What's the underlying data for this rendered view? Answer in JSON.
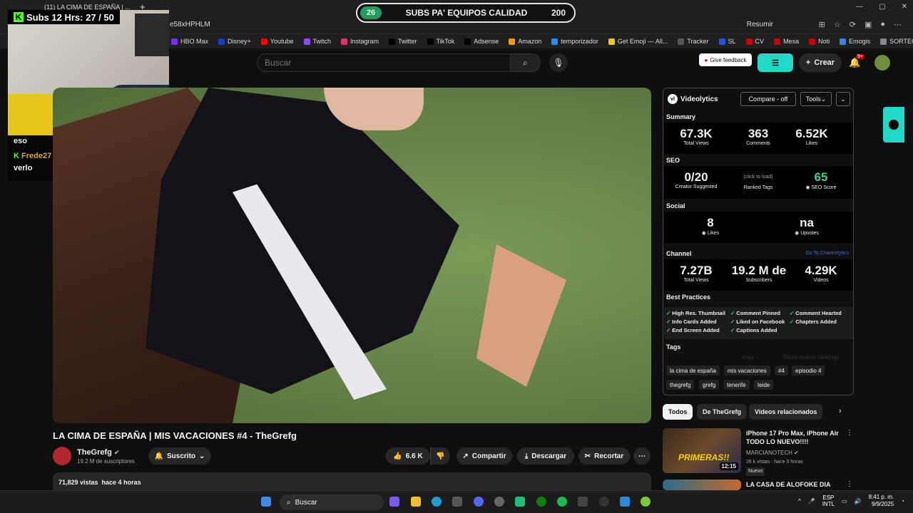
{
  "browser": {
    "tab_title": "(11) LA CIMA DE ESPAÑA | ...",
    "url": "e58xHPHLM",
    "resumir": "Resumir",
    "bookmarks": [
      "HBO Max",
      "Disney+",
      "Youtube",
      "Twitch",
      "Instagram",
      "Twitter",
      "TikTok",
      "Adsense",
      "Amazon",
      "temporizador",
      "Get Emoji — All...",
      "Tracker",
      "SL",
      "CV",
      "Mesa",
      "Noti",
      "Emogis",
      "SORTEO PICKER"
    ],
    "bookmark_colors": [
      "#7b2cf5",
      "#1a3cc8",
      "#ff0000",
      "#9146ff",
      "#e1306c",
      "#000000",
      "#000000",
      "#000000",
      "#ff9900",
      "#1e90ff",
      "#f5c518",
      "#555555",
      "#2455d6",
      "#cc0000",
      "#cc0000",
      "#cc0000",
      "#2e8ae6",
      "#888888"
    ]
  },
  "overlay": {
    "subs_goal": {
      "start": "26",
      "label": "SUBS PA' EQUIPOS CALIDAD",
      "end": "200"
    },
    "subs_counter": "Subs 12 Hrs: 27 / 50",
    "chat": [
      {
        "user": "",
        "text": "eso"
      },
      {
        "user": "Frede27",
        "text": ": póngase al grefg ahí pa verlo"
      }
    ]
  },
  "header": {
    "search_placeholder": "Buscar",
    "feedback": "Give feedback",
    "create": "Crear",
    "notif_badge": "9+"
  },
  "video": {
    "title": "LA CIMA DE ESPAÑA | MIS VACACIONES #4 - TheGrefg",
    "channel": "TheGrefg",
    "channel_subs": "19.2 M de suscriptores",
    "subscribed": "Suscrito",
    "likes": "6.6 K",
    "share": "Compartir",
    "download": "Descargar",
    "clip": "Recortar",
    "description": "71,829 vistas  hace 4 horas"
  },
  "videolytics": {
    "name": "Videolytics",
    "compare": "Compare - off",
    "tools": "Tools",
    "summary_label": "Summary",
    "summary": [
      {
        "value": "67.3K",
        "label": "Total Views"
      },
      {
        "value": "363",
        "label": "Comments"
      },
      {
        "value": "6.52K",
        "label": "Likes"
      }
    ],
    "seo_label": "SEO",
    "seo": [
      {
        "value": "0/20",
        "label": "Creator Suggested"
      },
      {
        "value": "(click to load)",
        "label": "Ranked Tags"
      },
      {
        "value": "65",
        "label": "SEO Score"
      }
    ],
    "social_label": "Social",
    "social": [
      {
        "value": "8",
        "label": "Likes"
      },
      {
        "value": "na",
        "label": "Upvotes"
      }
    ],
    "channel_label": "Channel",
    "channel_link": "Go To Channelytics",
    "channel": [
      {
        "value": "7.27B",
        "label": "Total Views"
      },
      {
        "value": "19.2 M de",
        "label": "Subscribers"
      },
      {
        "value": "4.29K",
        "label": "Videos"
      }
    ],
    "bp_label": "Best Practices",
    "best_practices": [
      "High Res. Thumbnail",
      "Comment Pinned",
      "Comment Hearted",
      "Info Cards Added",
      "Liked on Facebook",
      "Chapters Added",
      "End Screen Added",
      "Captions Added"
    ],
    "tags_label": "Tags",
    "tags_copy": "copy",
    "tags_rank": "Show search rankings",
    "tags": [
      "la cima de españa",
      "mis vacaciones",
      "#4",
      "episodio 4",
      "thegrefg",
      "grefg",
      "tenerife",
      "teide"
    ]
  },
  "chips": [
    "Todos",
    "De TheGrefg",
    "Videos relacionados"
  ],
  "related": [
    {
      "title": "iPhone 17 Pro Max, iPhone Air TODO LO NUEVO!!!!",
      "channel": "MARCIANOTECH",
      "meta": "26 k vistas · hace 3 horas",
      "badge": "Nuevo",
      "duration": "12:15",
      "thumb_text": "PRIMERAS!!"
    },
    {
      "title": "LA CASA DE ALOFOKE DIA 29"
    }
  ],
  "taskbar": {
    "search": "Buscar",
    "lang1": "ESP",
    "lang2": "INTL",
    "time": "8:41 p. m.",
    "date": "9/9/2025"
  }
}
